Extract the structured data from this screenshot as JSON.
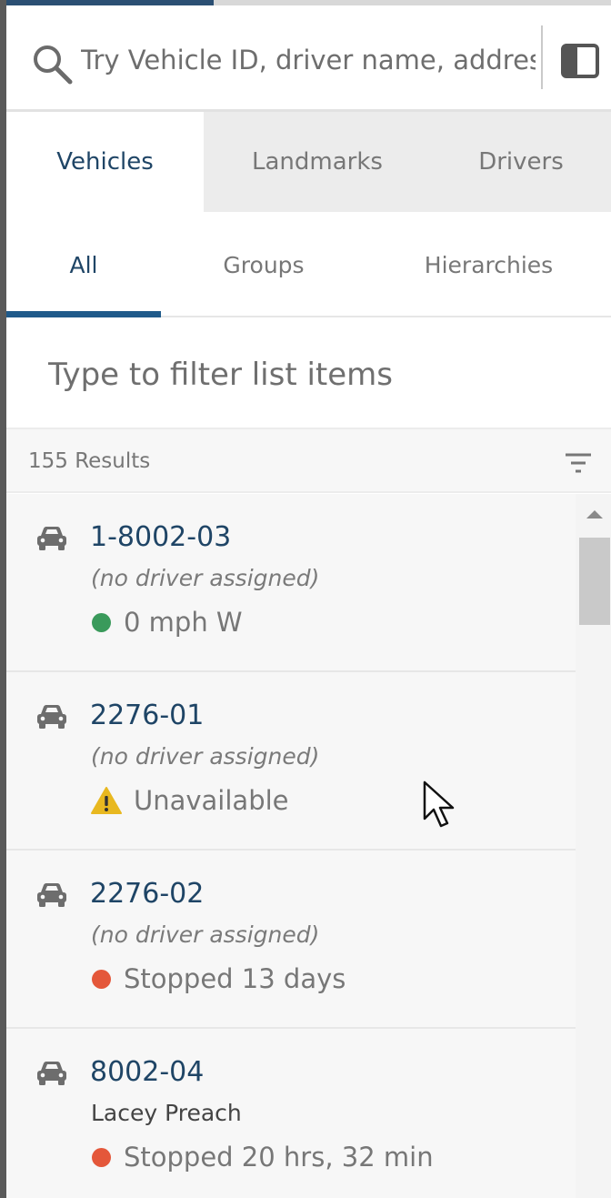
{
  "search": {
    "placeholder": "Try Vehicle ID, driver name, address",
    "icon": "search-icon",
    "panel_icon": "panel-toggle-icon"
  },
  "main_tabs": [
    {
      "label": "Vehicles",
      "active": true
    },
    {
      "label": "Landmarks",
      "active": false
    },
    {
      "label": "Drivers",
      "active": false
    }
  ],
  "sub_tabs": [
    {
      "label": "All",
      "active": true
    },
    {
      "label": "Groups",
      "active": false
    },
    {
      "label": "Hierarchies",
      "active": false
    }
  ],
  "filter": {
    "placeholder": "Type to filter list items"
  },
  "results": {
    "count_label": "155 Results",
    "sort_icon": "filter-lines-icon"
  },
  "vehicles": [
    {
      "id": "1-8002-03",
      "driver": "(no driver assigned)",
      "status": "0 mph W",
      "status_type": "moving",
      "status_color": "#3a9a5b"
    },
    {
      "id": "2276-01",
      "driver": "(no driver assigned)",
      "status": "Unavailable",
      "status_type": "warning",
      "status_color": "#e8b820"
    },
    {
      "id": "2276-02",
      "driver": "(no driver assigned)",
      "status": "Stopped 13 days",
      "status_type": "stopped",
      "status_color": "#e4573a"
    },
    {
      "id": "8002-04",
      "driver": "Lacey Preach",
      "status": "Stopped 20 hrs, 32 min",
      "status_type": "stopped",
      "status_color": "#e4573a"
    }
  ],
  "colors": {
    "accent": "#1f4566",
    "tab_underline": "#1f5a8a",
    "moving": "#3a9a5b",
    "stopped": "#e4573a",
    "warning": "#e8b820"
  }
}
